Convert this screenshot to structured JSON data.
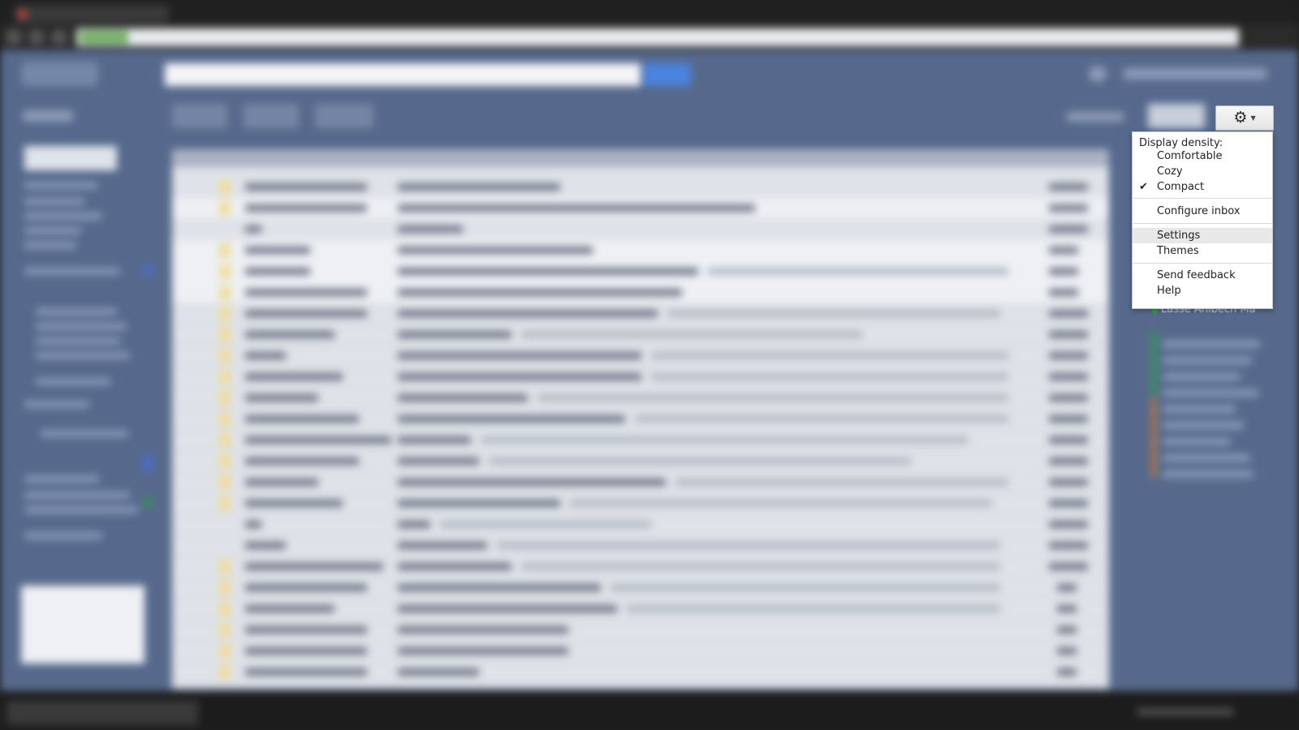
{
  "settings_button": {
    "gear_icon": "gear-icon",
    "caret_icon": "caret-down-icon",
    "gear_glyph": "⚙",
    "caret_glyph": "▼"
  },
  "settings_menu": {
    "density_header": "Display density:",
    "density_options": [
      {
        "label": "Comfortable",
        "checked": false
      },
      {
        "label": "Cozy",
        "checked": false
      },
      {
        "label": "Compact",
        "checked": true
      }
    ],
    "check_glyph": "✔",
    "configure_inbox": "Configure inbox",
    "settings": "Settings",
    "themes": "Themes",
    "send_feedback": "Send feedback",
    "help": "Help"
  },
  "chat": {
    "visible_contact": "Lasse Ahlbech Ma"
  },
  "colors": {
    "gmail_theme_bg": "#56698c",
    "menu_hover": "#e8e8e8"
  }
}
